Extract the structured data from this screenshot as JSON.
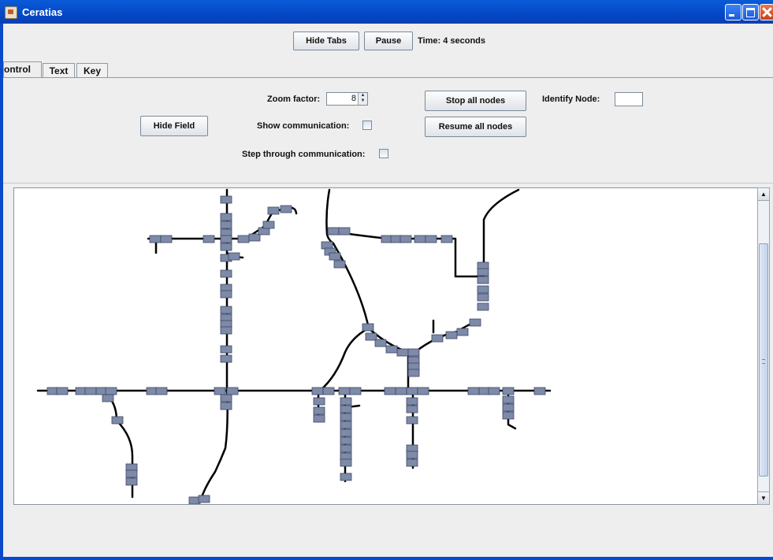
{
  "window": {
    "title": "Ceratias"
  },
  "toolbar": {
    "hide_tabs_label": "Hide Tabs",
    "pause_label": "Pause",
    "time_text": "Time: 4 seconds"
  },
  "tabs": [
    {
      "label": "ontrol",
      "selected": true
    },
    {
      "label": "Text",
      "selected": false
    },
    {
      "label": "Key",
      "selected": false
    }
  ],
  "control": {
    "hide_field_label": "Hide Field",
    "zoom_label": "Zoom factor:",
    "zoom_value": "8",
    "show_comm_label": "Show communication:",
    "show_comm_checked": false,
    "step_comm_label": "Step through communication:",
    "step_comm_checked": false,
    "stop_all_label": "Stop all nodes",
    "resume_all_label": "Resume all nodes",
    "identify_label": "Identify Node:",
    "identify_value": ""
  },
  "icons": [
    "app-icon",
    "minimize-icon",
    "maximize-icon",
    "close-icon",
    "scroll-up-icon",
    "scroll-down-icon",
    "sensor-node-icon"
  ]
}
